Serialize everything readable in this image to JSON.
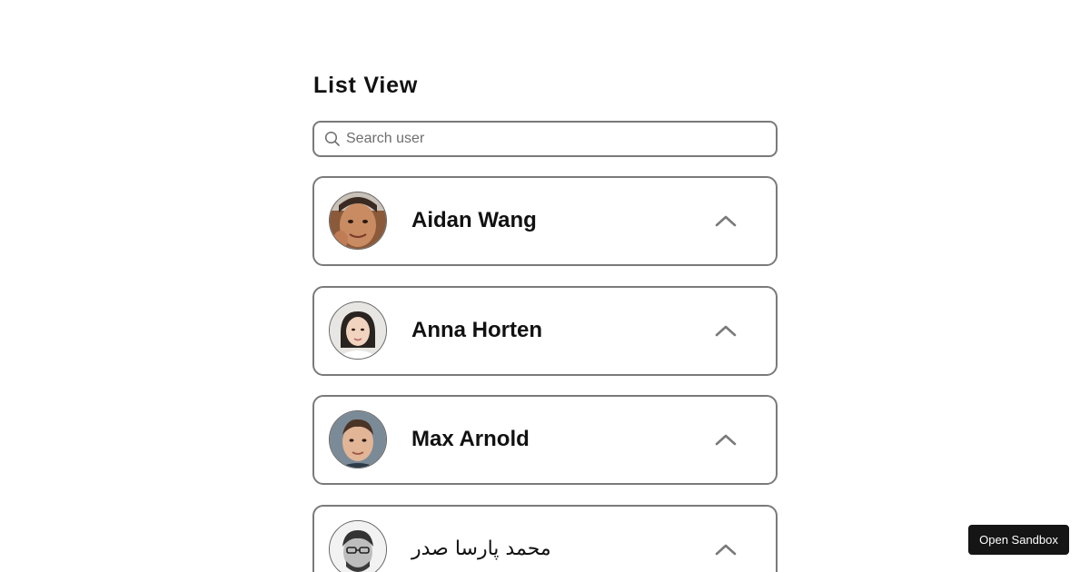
{
  "header": {
    "title": "List View"
  },
  "search": {
    "placeholder": "Search user",
    "value": "",
    "icon": "search-icon"
  },
  "users": [
    {
      "name": "Aidan Wang",
      "avatar": "avatar-photo",
      "expand_icon": "chevron-up-icon"
    },
    {
      "name": "Anna Horten",
      "avatar": "avatar-photo",
      "expand_icon": "chevron-up-icon"
    },
    {
      "name": "Max Arnold",
      "avatar": "avatar-photo",
      "expand_icon": "chevron-up-icon"
    },
    {
      "name": "محمد پارسا صدر",
      "avatar": "avatar-photo",
      "expand_icon": "chevron-up-icon"
    }
  ],
  "sandbox_button": {
    "label": "Open Sandbox"
  },
  "colors": {
    "border": "#7a7a7a",
    "text": "#111111",
    "button_bg": "#151515",
    "button_text": "#ffffff",
    "chevron": "#7a7a7a"
  }
}
